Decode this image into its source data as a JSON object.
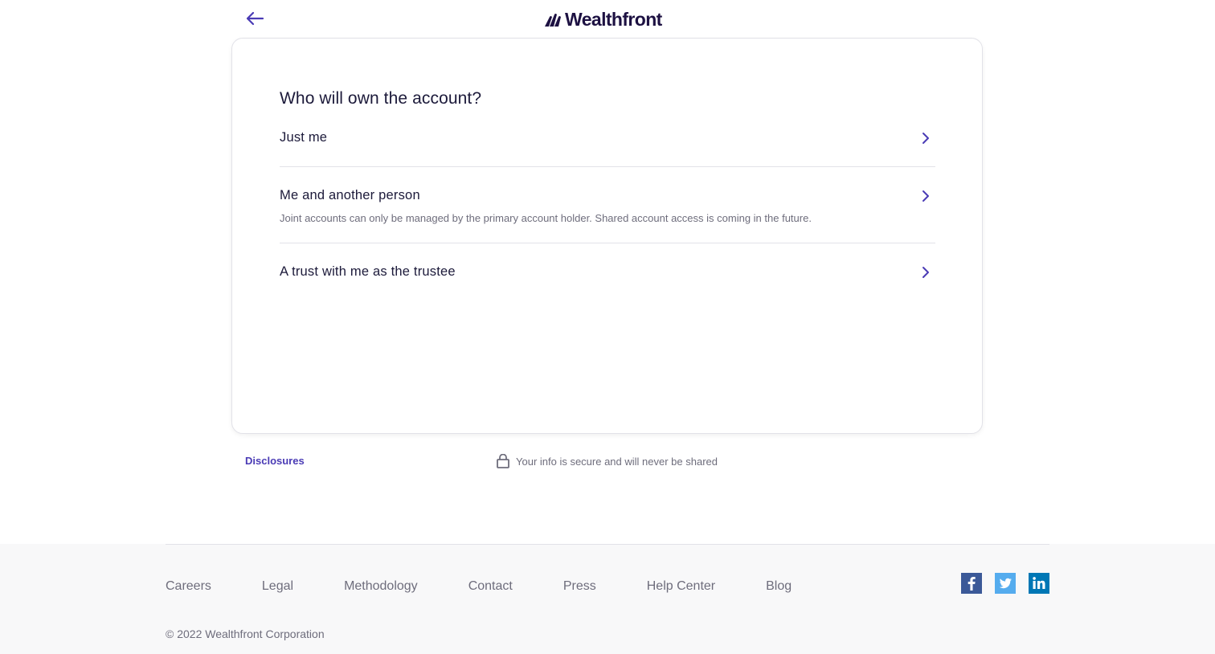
{
  "header": {
    "logo_text": "Wealthfront",
    "brand_color": "#1d1142",
    "accent_color": "#4a3bb5"
  },
  "card": {
    "question": "Who will own the account?",
    "options": [
      {
        "title": "Just me",
        "subtitle": ""
      },
      {
        "title": "Me and another person",
        "subtitle": "Joint accounts can only be managed by the primary account holder. Shared account access is coming in the future."
      },
      {
        "title": "A trust with me as the trustee",
        "subtitle": ""
      }
    ]
  },
  "below_card": {
    "disclosures": "Disclosures",
    "secure_text": "Your info is secure and will never be shared"
  },
  "footer": {
    "links": [
      "Careers",
      "Legal",
      "Methodology",
      "Contact",
      "Press",
      "Help Center",
      "Blog"
    ],
    "social": [
      {
        "icon": "facebook-icon",
        "color": "#3b5998"
      },
      {
        "icon": "twitter-icon",
        "color": "#55acee"
      },
      {
        "icon": "linkedin-icon",
        "color": "#0077b5"
      }
    ],
    "copyright": "© 2022 Wealthfront Corporation"
  }
}
